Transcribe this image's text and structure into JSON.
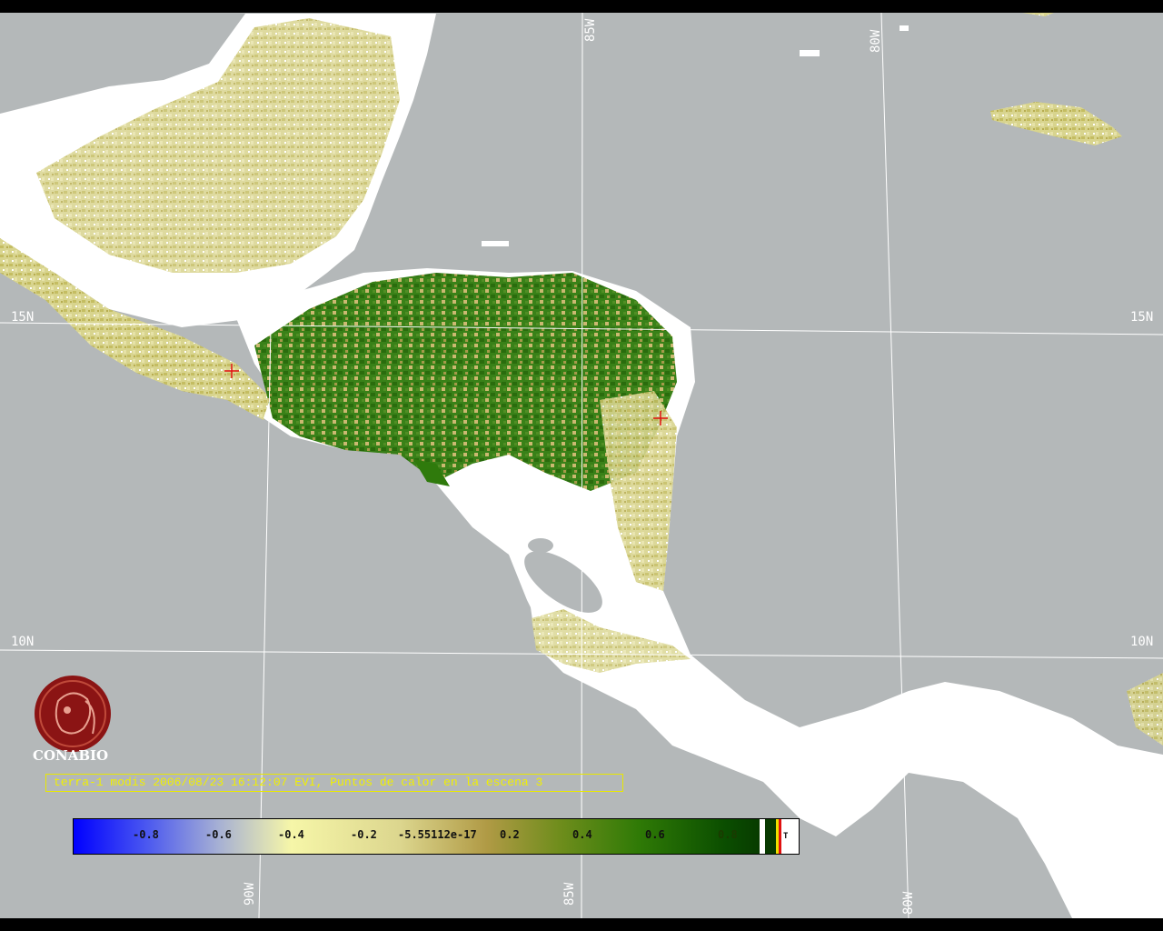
{
  "map": {
    "grid_labels": {
      "lat_15n": "15N",
      "lat_10n": "10N",
      "lon_85w": "85W",
      "lon_80w": "80W",
      "lon_90w": "90W"
    },
    "colors": {
      "ocean": "#b4b8b9",
      "land_no_data": "#ffffff",
      "grid": "#ffffff"
    },
    "hotspot_markers": [
      "hotspot",
      "hotspot"
    ]
  },
  "logo": {
    "icon": "conabio-logo-icon",
    "label": "CONABIO"
  },
  "caption": "terra-1 modis 2006/08/23 16:12:07 EVI, Puntos de calor en la escena 3",
  "colorbar": {
    "ticks": [
      "-0.8",
      "-0.6",
      "-0.4",
      "-0.2",
      "-5.55112e-17",
      "0.2",
      "0.4",
      "0.6",
      "0.8"
    ],
    "end_label": "T"
  }
}
